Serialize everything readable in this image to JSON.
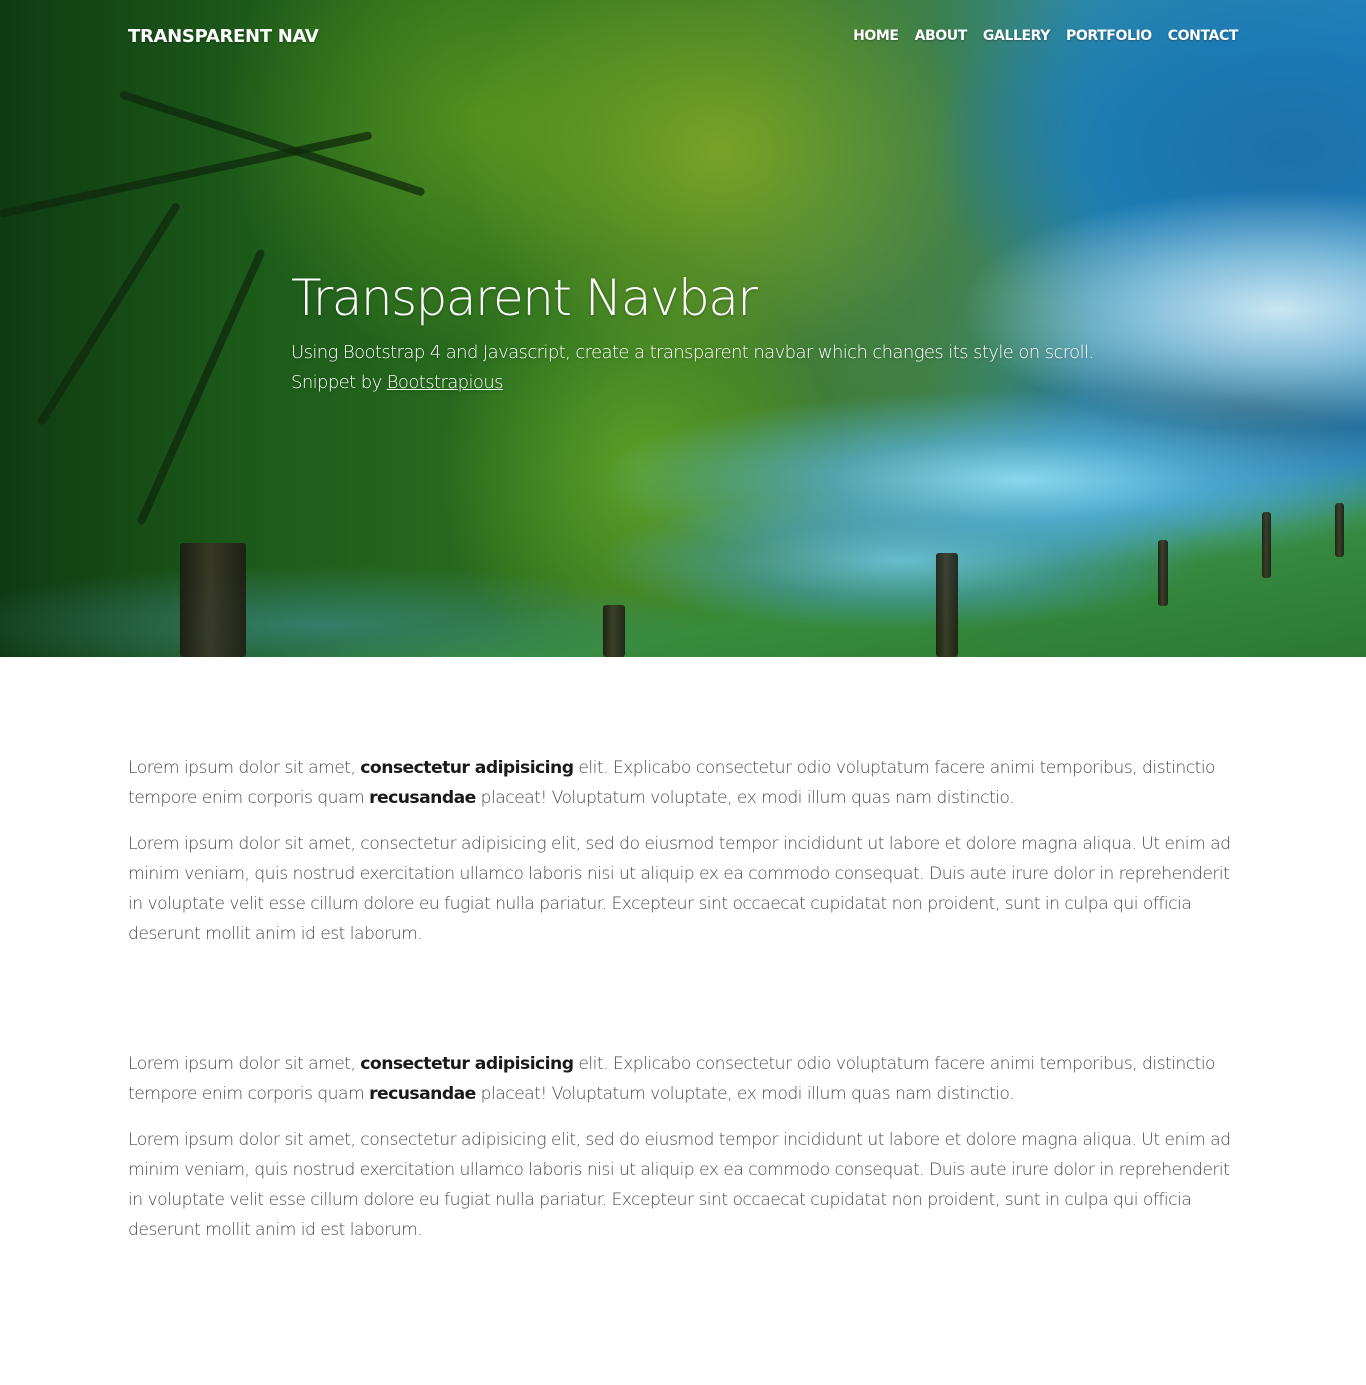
{
  "navbar": {
    "brand": "TRANSPARENT NAV",
    "links": [
      {
        "label": "HOME"
      },
      {
        "label": "ABOUT"
      },
      {
        "label": "GALLERY"
      },
      {
        "label": "PORTFOLIO"
      },
      {
        "label": "CONTACT"
      }
    ]
  },
  "hero": {
    "title": "Transparent Navbar",
    "subtitle": "Using Bootstrap 4 and Javascript, create a transparent navbar which changes its style on scroll.",
    "credit_prefix": "Snippet by ",
    "credit_link": "Bootstrapious",
    "image_description": "misty forest river landscape with fence posts"
  },
  "content": {
    "sections": [
      {
        "intro": {
          "part1": "Lorem ipsum dolor sit amet, ",
          "bold1": "consectetur adipisicing",
          "part2": " elit. Explicabo consectetur odio voluptatum facere animi temporibus, distinctio tempore enim corporis quam ",
          "bold2": "recusandae",
          "part3": " placeat! Voluptatum voluptate, ex modi illum quas nam distinctio."
        },
        "body": "Lorem ipsum dolor sit amet, consectetur adipisicing elit, sed do eiusmod tempor incididunt ut labore et dolore magna aliqua. Ut enim ad minim veniam, quis nostrud exercitation ullamco laboris nisi ut aliquip ex ea commodo consequat. Duis aute irure dolor in reprehenderit in voluptate velit esse cillum dolore eu fugiat nulla pariatur. Excepteur sint occaecat cupidatat non proident, sunt in culpa qui officia deserunt mollit anim id est laborum."
      },
      {
        "intro": {
          "part1": "Lorem ipsum dolor sit amet, ",
          "bold1": "consectetur adipisicing",
          "part2": " elit. Explicabo consectetur odio voluptatum facere animi temporibus, distinctio tempore enim corporis quam ",
          "bold2": "recusandae",
          "part3": " placeat! Voluptatum voluptate, ex modi illum quas nam distinctio."
        },
        "body": "Lorem ipsum dolor sit amet, consectetur adipisicing elit, sed do eiusmod tempor incididunt ut labore et dolore magna aliqua. Ut enim ad minim veniam, quis nostrud exercitation ullamco laboris nisi ut aliquip ex ea commodo consequat. Duis aute irure dolor in reprehenderit in voluptate velit esse cillum dolore eu fugiat nulla pariatur. Excepteur sint occaecat cupidatat non proident, sunt in culpa qui officia deserunt mollit anim id est laborum."
      }
    ]
  }
}
